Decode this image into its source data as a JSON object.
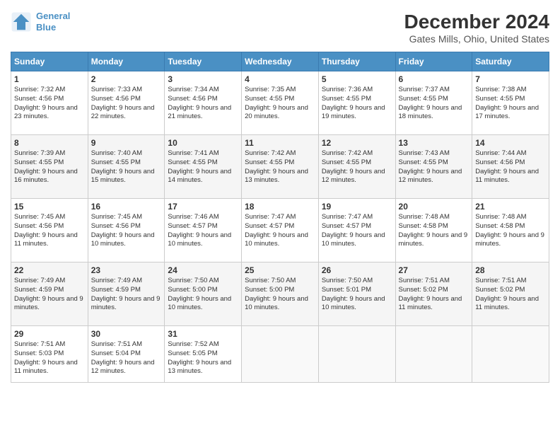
{
  "header": {
    "logo_line1": "General",
    "logo_line2": "Blue",
    "title": "December 2024",
    "subtitle": "Gates Mills, Ohio, United States"
  },
  "days_of_week": [
    "Sunday",
    "Monday",
    "Tuesday",
    "Wednesday",
    "Thursday",
    "Friday",
    "Saturday"
  ],
  "weeks": [
    [
      {
        "day": "1",
        "sunrise": "7:32 AM",
        "sunset": "4:56 PM",
        "daylight": "9 hours and 23 minutes."
      },
      {
        "day": "2",
        "sunrise": "7:33 AM",
        "sunset": "4:56 PM",
        "daylight": "9 hours and 22 minutes."
      },
      {
        "day": "3",
        "sunrise": "7:34 AM",
        "sunset": "4:56 PM",
        "daylight": "9 hours and 21 minutes."
      },
      {
        "day": "4",
        "sunrise": "7:35 AM",
        "sunset": "4:55 PM",
        "daylight": "9 hours and 20 minutes."
      },
      {
        "day": "5",
        "sunrise": "7:36 AM",
        "sunset": "4:55 PM",
        "daylight": "9 hours and 19 minutes."
      },
      {
        "day": "6",
        "sunrise": "7:37 AM",
        "sunset": "4:55 PM",
        "daylight": "9 hours and 18 minutes."
      },
      {
        "day": "7",
        "sunrise": "7:38 AM",
        "sunset": "4:55 PM",
        "daylight": "9 hours and 17 minutes."
      }
    ],
    [
      {
        "day": "8",
        "sunrise": "7:39 AM",
        "sunset": "4:55 PM",
        "daylight": "9 hours and 16 minutes."
      },
      {
        "day": "9",
        "sunrise": "7:40 AM",
        "sunset": "4:55 PM",
        "daylight": "9 hours and 15 minutes."
      },
      {
        "day": "10",
        "sunrise": "7:41 AM",
        "sunset": "4:55 PM",
        "daylight": "9 hours and 14 minutes."
      },
      {
        "day": "11",
        "sunrise": "7:42 AM",
        "sunset": "4:55 PM",
        "daylight": "9 hours and 13 minutes."
      },
      {
        "day": "12",
        "sunrise": "7:42 AM",
        "sunset": "4:55 PM",
        "daylight": "9 hours and 12 minutes."
      },
      {
        "day": "13",
        "sunrise": "7:43 AM",
        "sunset": "4:55 PM",
        "daylight": "9 hours and 12 minutes."
      },
      {
        "day": "14",
        "sunrise": "7:44 AM",
        "sunset": "4:56 PM",
        "daylight": "9 hours and 11 minutes."
      }
    ],
    [
      {
        "day": "15",
        "sunrise": "7:45 AM",
        "sunset": "4:56 PM",
        "daylight": "9 hours and 11 minutes."
      },
      {
        "day": "16",
        "sunrise": "7:45 AM",
        "sunset": "4:56 PM",
        "daylight": "9 hours and 10 minutes."
      },
      {
        "day": "17",
        "sunrise": "7:46 AM",
        "sunset": "4:57 PM",
        "daylight": "9 hours and 10 minutes."
      },
      {
        "day": "18",
        "sunrise": "7:47 AM",
        "sunset": "4:57 PM",
        "daylight": "9 hours and 10 minutes."
      },
      {
        "day": "19",
        "sunrise": "7:47 AM",
        "sunset": "4:57 PM",
        "daylight": "9 hours and 10 minutes."
      },
      {
        "day": "20",
        "sunrise": "7:48 AM",
        "sunset": "4:58 PM",
        "daylight": "9 hours and 9 minutes."
      },
      {
        "day": "21",
        "sunrise": "7:48 AM",
        "sunset": "4:58 PM",
        "daylight": "9 hours and 9 minutes."
      }
    ],
    [
      {
        "day": "22",
        "sunrise": "7:49 AM",
        "sunset": "4:59 PM",
        "daylight": "9 hours and 9 minutes."
      },
      {
        "day": "23",
        "sunrise": "7:49 AM",
        "sunset": "4:59 PM",
        "daylight": "9 hours and 9 minutes."
      },
      {
        "day": "24",
        "sunrise": "7:50 AM",
        "sunset": "5:00 PM",
        "daylight": "9 hours and 10 minutes."
      },
      {
        "day": "25",
        "sunrise": "7:50 AM",
        "sunset": "5:00 PM",
        "daylight": "9 hours and 10 minutes."
      },
      {
        "day": "26",
        "sunrise": "7:50 AM",
        "sunset": "5:01 PM",
        "daylight": "9 hours and 10 minutes."
      },
      {
        "day": "27",
        "sunrise": "7:51 AM",
        "sunset": "5:02 PM",
        "daylight": "9 hours and 11 minutes."
      },
      {
        "day": "28",
        "sunrise": "7:51 AM",
        "sunset": "5:02 PM",
        "daylight": "9 hours and 11 minutes."
      }
    ],
    [
      {
        "day": "29",
        "sunrise": "7:51 AM",
        "sunset": "5:03 PM",
        "daylight": "9 hours and 11 minutes."
      },
      {
        "day": "30",
        "sunrise": "7:51 AM",
        "sunset": "5:04 PM",
        "daylight": "9 hours and 12 minutes."
      },
      {
        "day": "31",
        "sunrise": "7:52 AM",
        "sunset": "5:05 PM",
        "daylight": "9 hours and 13 minutes."
      },
      null,
      null,
      null,
      null
    ]
  ]
}
